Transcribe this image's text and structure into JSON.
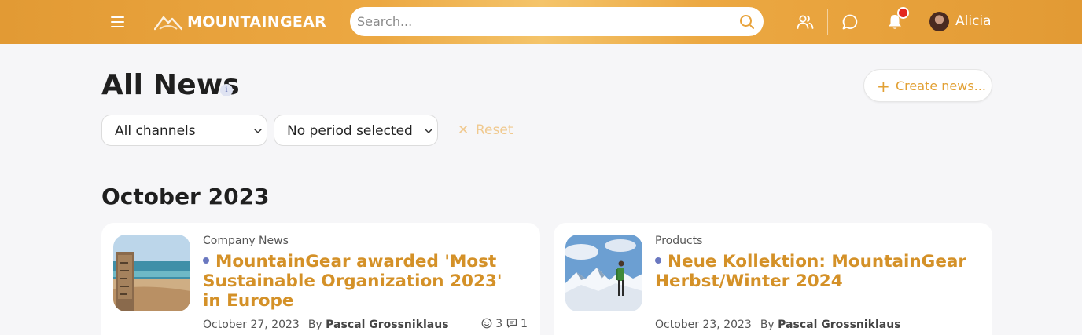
{
  "header": {
    "logo_text": "MOUNTAINGEAR",
    "search_placeholder": "Search...",
    "user_name": "Alicia"
  },
  "page": {
    "title": "All News",
    "create_button": "Create news..."
  },
  "filters": {
    "channel": "All channels",
    "period": "No period selected",
    "reset": "Reset"
  },
  "month_heading": "October 2023",
  "news": [
    {
      "category": "Company News",
      "title": "MountainGear awarded 'Most Sustainable Organization 2023' in Europe",
      "date": "October 27, 2023",
      "by_label": "By",
      "author": "Pascal Grossniklaus",
      "reactions": "3",
      "comments": "1"
    },
    {
      "category": "Products",
      "title": "Neue Kollektion: MountainGear Herbst/Winter 2024",
      "date": "October 23, 2023",
      "by_label": "By",
      "author": "Pascal Grossniklaus"
    }
  ],
  "colors": {
    "header_orange": "#e8a23a",
    "title_gold": "#d49128",
    "unread_dot": "#6a78c0",
    "notification": "#e3281f"
  },
  "icons": [
    "menu-icon",
    "mountain-logo-icon",
    "search-icon",
    "people-icon",
    "chat-icon",
    "bell-icon",
    "info-icon",
    "plus-icon",
    "chevron-down-icon",
    "close-icon",
    "smiley-icon",
    "comment-icon"
  ]
}
